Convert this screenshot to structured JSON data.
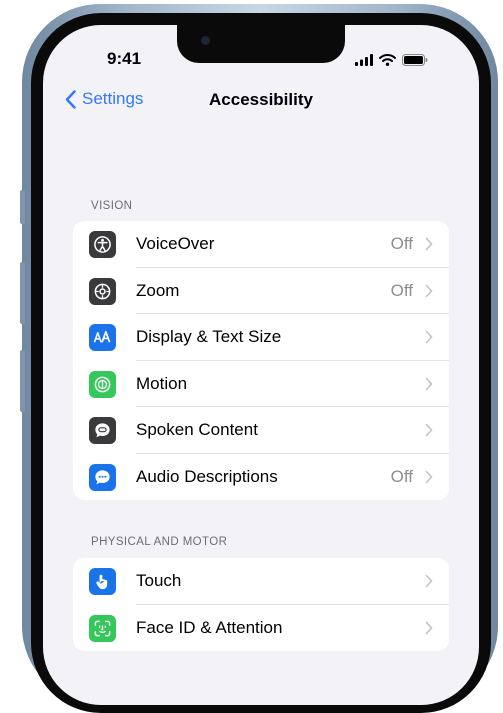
{
  "status_bar": {
    "time": "9:41"
  },
  "nav": {
    "back_label": "Settings",
    "title": "Accessibility"
  },
  "sections": [
    {
      "header": "VISION",
      "items": [
        {
          "label": "VoiceOver",
          "value": "Off",
          "icon": "voiceover-icon",
          "icon_color": "#3a3a3c"
        },
        {
          "label": "Zoom",
          "value": "Off",
          "icon": "zoom-icon",
          "icon_color": "#3a3a3c"
        },
        {
          "label": "Display & Text Size",
          "value": "",
          "icon": "display-text-size-icon",
          "icon_color": "#1a73e8"
        },
        {
          "label": "Motion",
          "value": "",
          "icon": "motion-icon",
          "icon_color": "#34c759"
        },
        {
          "label": "Spoken Content",
          "value": "",
          "icon": "spoken-content-icon",
          "icon_color": "#3a3a3c"
        },
        {
          "label": "Audio Descriptions",
          "value": "Off",
          "icon": "audio-descriptions-icon",
          "icon_color": "#1a73e8"
        }
      ]
    },
    {
      "header": "PHYSICAL AND MOTOR",
      "items": [
        {
          "label": "Touch",
          "value": "",
          "icon": "touch-icon",
          "icon_color": "#1a73e8"
        },
        {
          "label": "Face ID & Attention",
          "value": "",
          "icon": "face-id-icon",
          "icon_color": "#34c759"
        }
      ]
    }
  ],
  "colors": {
    "accent": "#3478f6",
    "background": "#f2f2f7"
  }
}
